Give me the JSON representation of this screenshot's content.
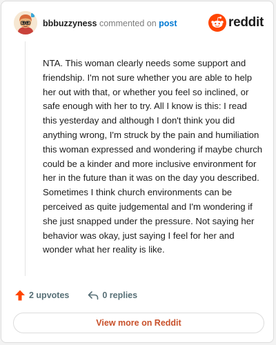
{
  "header": {
    "username": "bbbuzzyness",
    "action_text": "commented on",
    "post_link": "post",
    "brand_name": "reddit"
  },
  "comment": {
    "body": "NTA. This woman clearly needs some support and friendship. I'm not sure whether you are able to help her out with that, or whether you feel so inclined, or safe enough with her to try. All I know is this: I read this yesterday and although I don't think you did anything wrong, I'm struck by the pain and humiliation this woman expressed and wondering if maybe church could be a kinder and more inclusive environment for her in the future than it was on the day you described. Sometimes I think church environments can be perceived as quite judgemental and I'm wondering if she just snapped under the pressure. Not saying her behavior was okay, just saying I feel for her and wonder what her reality is like."
  },
  "actions": {
    "upvotes_label": "2 upvotes",
    "replies_label": "0 replies",
    "upvote_icon": "arrow-up-icon",
    "reply_icon": "reply-arrow-icon"
  },
  "footer": {
    "view_more_label": "View more on Reddit"
  },
  "colors": {
    "brand_orange": "#ff4500",
    "link_blue": "#0079d3",
    "view_more_text": "#c8502a",
    "muted_text": "#576f76"
  }
}
